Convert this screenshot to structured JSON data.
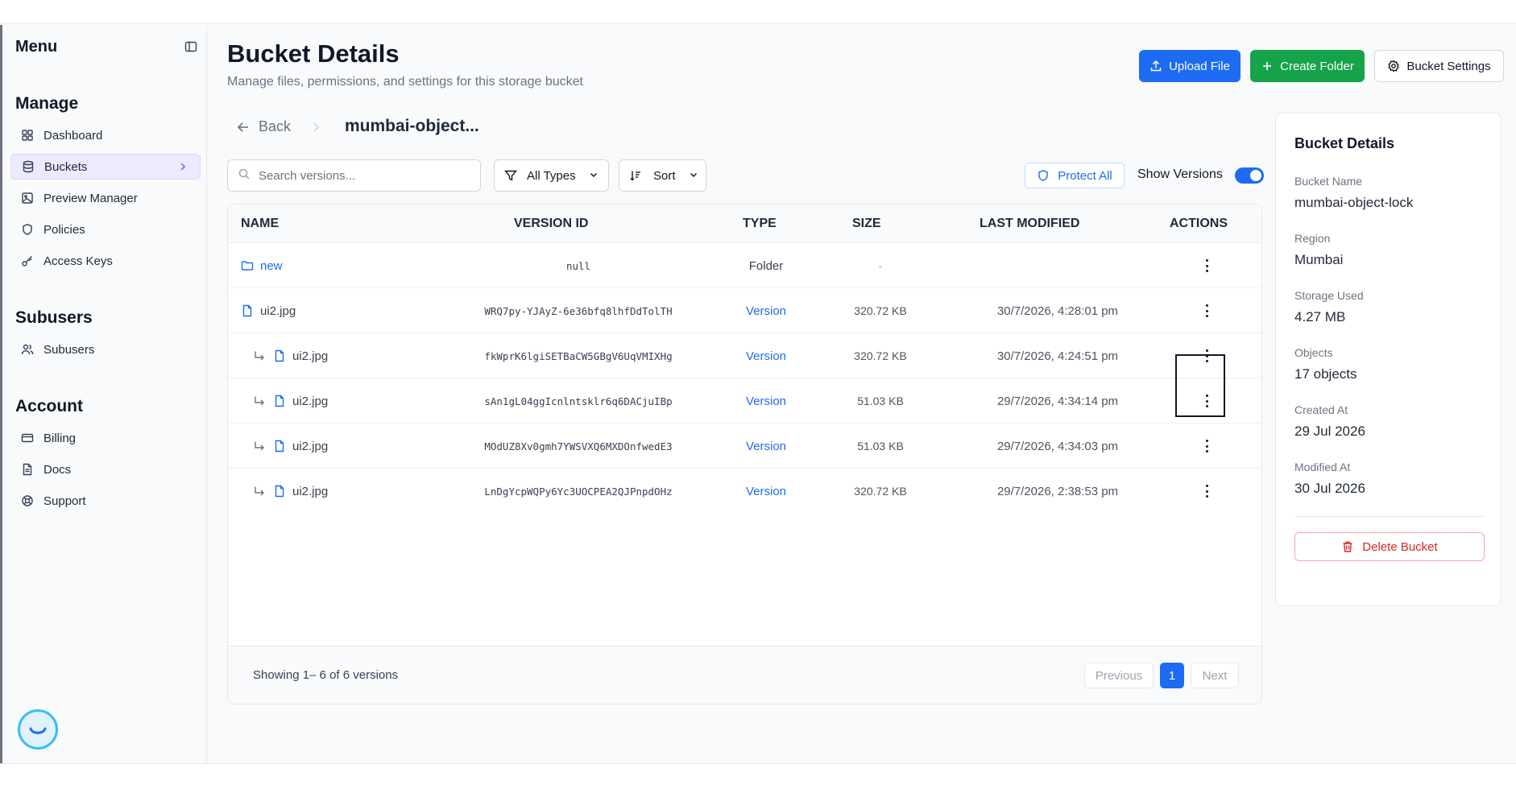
{
  "sidebar": {
    "title": "Menu",
    "sections": {
      "manage": "Manage",
      "subusers": "Subusers",
      "account": "Account"
    },
    "items": {
      "dashboard": "Dashboard",
      "buckets": "Buckets",
      "preview_manager": "Preview Manager",
      "policies": "Policies",
      "access_keys": "Access Keys",
      "subusers": "Subusers",
      "billing": "Billing",
      "docs": "Docs",
      "support": "Support"
    }
  },
  "header": {
    "title": "Bucket Details",
    "subtitle": "Manage files, permissions, and settings for this storage bucket",
    "upload_label": "Upload File",
    "create_folder_label": "Create Folder",
    "settings_label": "Bucket Settings"
  },
  "breadcrumb": {
    "back_label": "Back",
    "current": "mumbai-object..."
  },
  "toolbar": {
    "search_placeholder": "Search versions...",
    "type_filter": "All Types",
    "sort_label": "Sort",
    "protect_all_label": "Protect All",
    "show_versions_label": "Show Versions",
    "show_versions_on": true
  },
  "table": {
    "columns": {
      "name": "NAME",
      "version_id": "VERSION ID",
      "type": "TYPE",
      "size": "SIZE",
      "last_modified": "LAST MODIFIED",
      "actions": "ACTIONS"
    },
    "rows": [
      {
        "name": "new",
        "version_id": "null",
        "type": "Folder",
        "size": "-",
        "modified": ""
      },
      {
        "name": "ui2.jpg",
        "version_id": "WRQ7py-YJAyZ-6e36bfq8lhfDdTolTH",
        "type": "Version",
        "size": "320.72 KB",
        "modified": "30/7/2026, 4:28:01 pm"
      },
      {
        "name": "ui2.jpg",
        "version_id": "fkWprK6lgiSETBaCW5GBgV6UqVMIXHg",
        "type": "Version",
        "size": "320.72 KB",
        "modified": "30/7/2026, 4:24:51 pm"
      },
      {
        "name": "ui2.jpg",
        "version_id": "sAn1gL04ggIcnlntsklr6q6DACjuIBp",
        "type": "Version",
        "size": "51.03 KB",
        "modified": "29/7/2026, 4:34:14 pm"
      },
      {
        "name": "ui2.jpg",
        "version_id": "MOdUZ8Xv0gmh7YWSVXQ6MXDOnfwedE3",
        "type": "Version",
        "size": "51.03 KB",
        "modified": "29/7/2026, 4:34:03 pm"
      },
      {
        "name": "ui2.jpg",
        "version_id": "LnDgYcpWQPy6Yc3UOCPEA2QJPnpdOHz",
        "type": "Version",
        "size": "320.72 KB",
        "modified": "29/7/2026, 2:38:53 pm"
      }
    ],
    "footer": {
      "showing": "Showing 1– 6 of 6 versions",
      "previous": "Previous",
      "page": "1",
      "next": "Next"
    }
  },
  "panel": {
    "title": "Bucket Details",
    "bucket_name_label": "Bucket Name",
    "bucket_name": "mumbai-object-lock",
    "region_label": "Region",
    "region": "Mumbai",
    "storage_label": "Storage Used",
    "storage": "4.27 MB",
    "objects_label": "Objects",
    "objects": "17 objects",
    "created_label": "Created At",
    "created": "29 Jul 2026",
    "modified_label": "Modified At",
    "modified": "30 Jul 2026",
    "delete_label": "Delete Bucket"
  },
  "colors": {
    "accent": "#1d6bf3",
    "create": "#16a34a",
    "danger": "#dc2626",
    "active_nav": "#ede9fe"
  }
}
